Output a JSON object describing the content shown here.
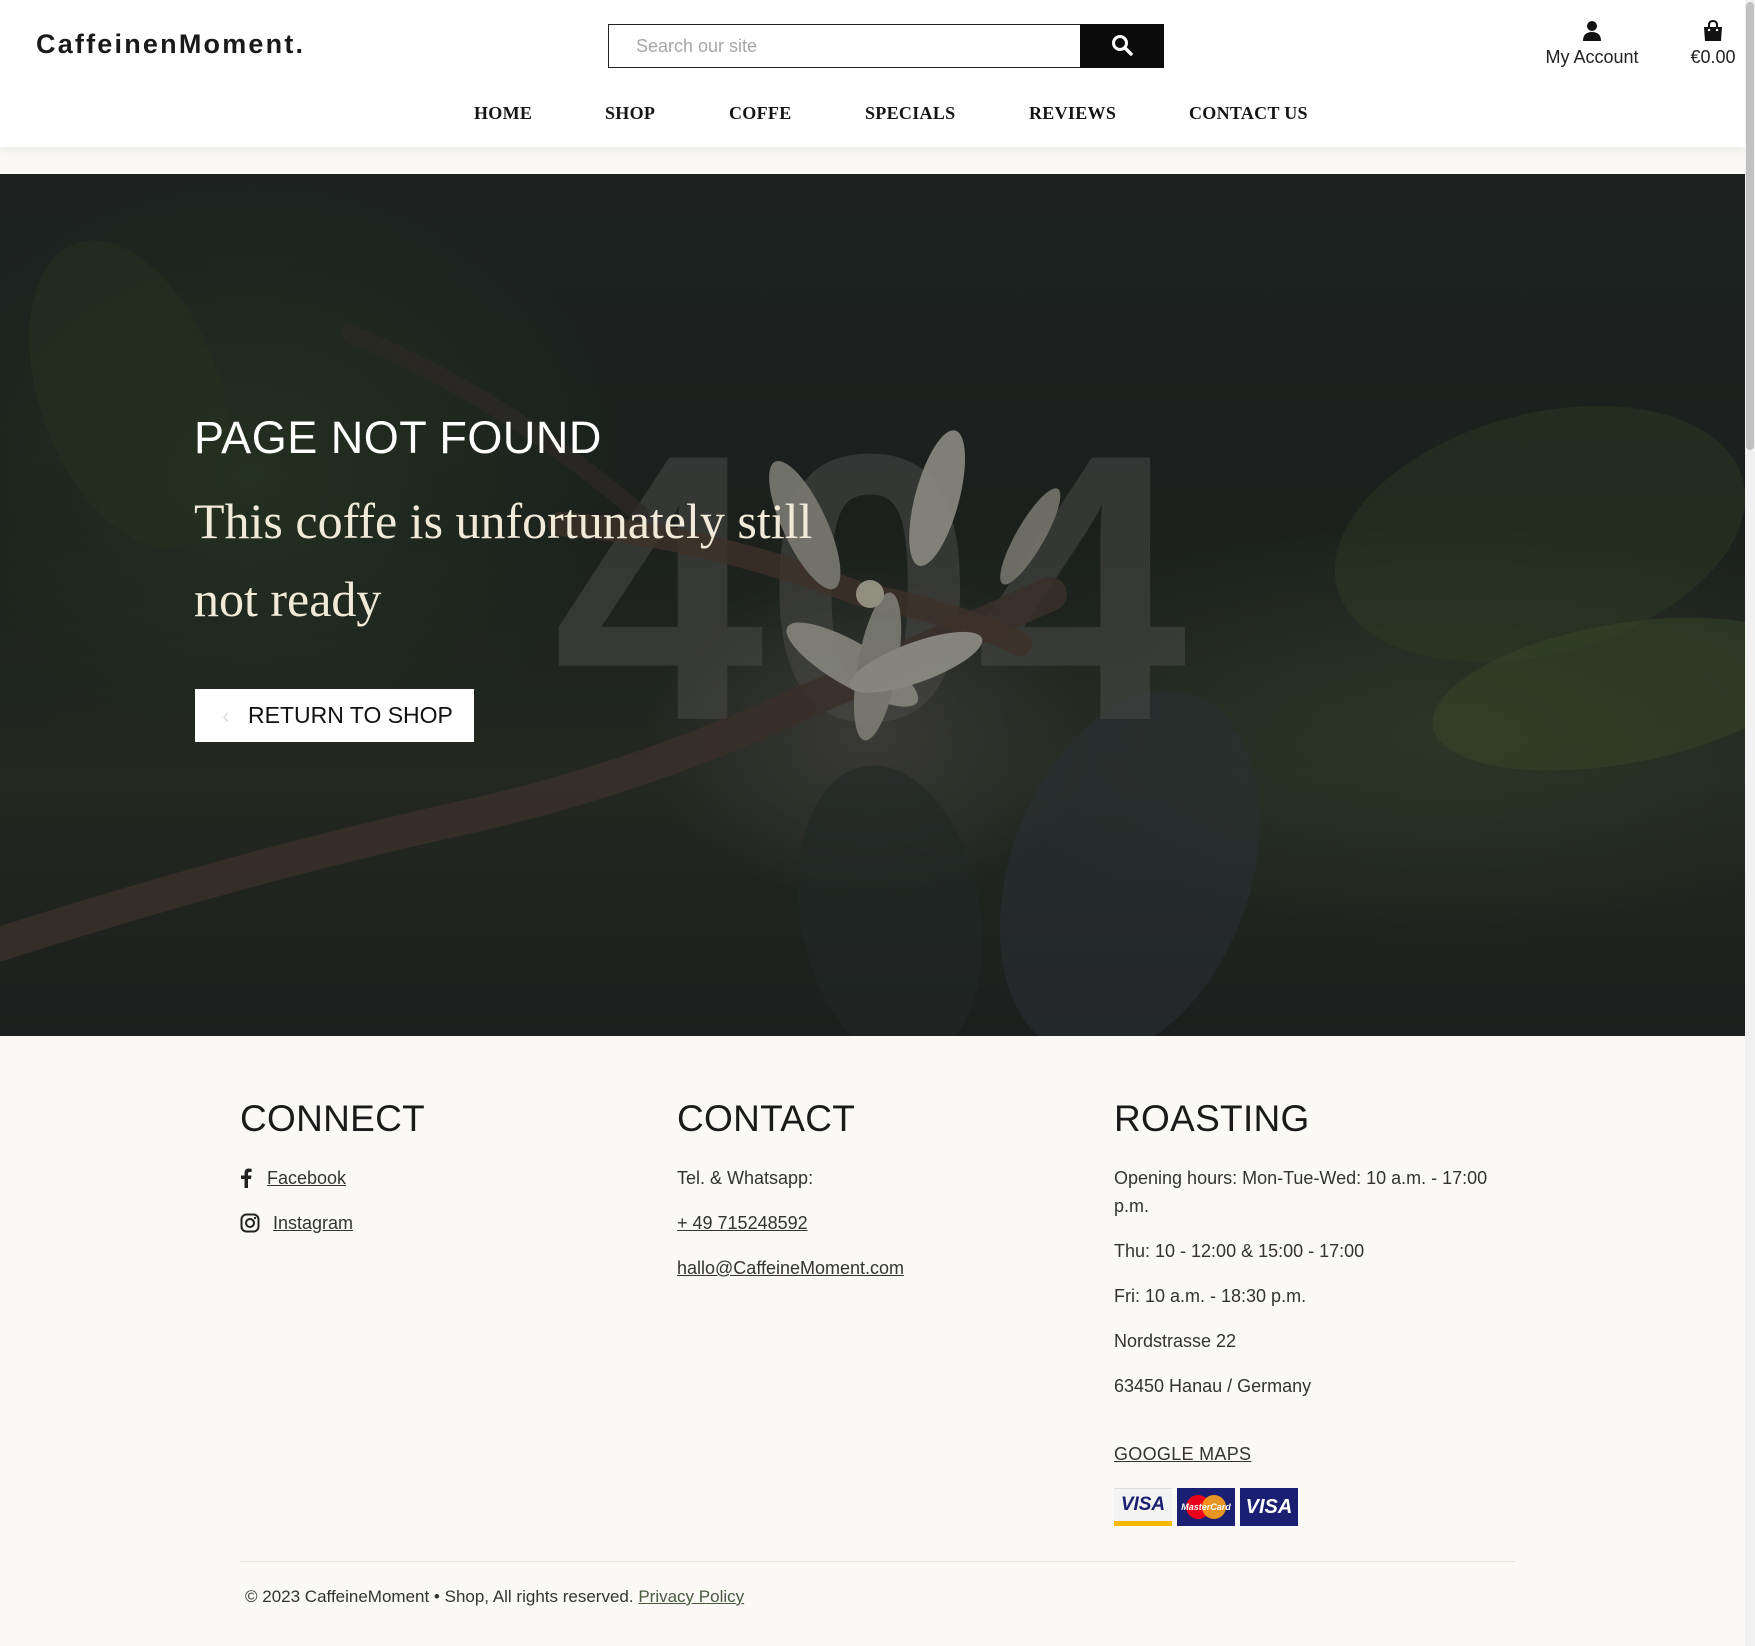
{
  "header": {
    "brand": "CaffeinenMoment.",
    "search": {
      "placeholder": "Search our site",
      "value": ""
    },
    "account_label": "My Account",
    "cart_total": "€0.00"
  },
  "nav": {
    "items": [
      {
        "label": "HOME"
      },
      {
        "label": "SHOP"
      },
      {
        "label": "COFFE"
      },
      {
        "label": "SPECIALS"
      },
      {
        "label": "REVIEWS"
      },
      {
        "label": "CONTACT US"
      }
    ]
  },
  "hero": {
    "title": "PAGE NOT FOUND",
    "subtitle": "This coffe is unfortunately still not ready",
    "background_number": "404",
    "button_label": "RETURN TO SHOP"
  },
  "footer": {
    "connect": {
      "heading": "CONNECT",
      "links": [
        {
          "label": "Facebook",
          "icon": "facebook-icon"
        },
        {
          "label": "Instagram",
          "icon": "instagram-icon"
        }
      ]
    },
    "contact": {
      "heading": "CONTACT",
      "phone_label": "Tel. & Whatsapp:",
      "phone": "+ 49 715248592",
      "email": "hallo@CaffeineMoment.com"
    },
    "roasting": {
      "heading": "ROASTING",
      "hours_1": "Opening hours: Mon-Tue-Wed: 10 a.m. - 17:00 p.m.",
      "hours_2": "Thu: 10 - 12:00 & 15:00 - 17:00",
      "hours_3": "Fri: 10 a.m. - 18:30 p.m.",
      "street": "Nordstrasse 22",
      "city": "63450 Hanau / Germany",
      "maps_link": "GOOGLE MAPS"
    },
    "payment_cards": [
      {
        "name": "VISA",
        "icon": "visa-electron-icon"
      },
      {
        "name": "MasterCard",
        "icon": "mastercard-icon"
      },
      {
        "name": "VISA",
        "icon": "visa-icon"
      }
    ],
    "copyright": "© 2023 CaffeineMoment • Shop, All rights reserved.",
    "privacy_link": "Privacy Policy"
  },
  "colors": {
    "header_bg": "#ffffff",
    "search_button": "#0b0b0b",
    "hero_overlay": "#1c211e",
    "footer_bg": "#faf9f6",
    "subtitle_text": "#f2ead8"
  }
}
